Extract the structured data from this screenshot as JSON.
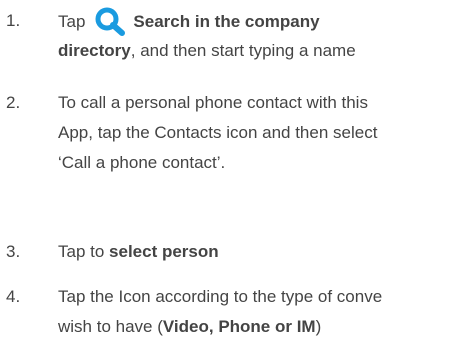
{
  "steps": [
    {
      "number": "1.",
      "prefix": "Tap",
      "icon": "search-icon",
      "icon_color": "#1a9be0",
      "bold_a": "Search in the company",
      "bold_b": "directory",
      "rest": ", and then start typing a name"
    },
    {
      "number": "2.",
      "line1": "To call a personal phone contact with this",
      "line2": "App, tap the Contacts icon and then select",
      "line3": "‘Call a phone contact’."
    },
    {
      "number": "3.",
      "prefix": "Tap to ",
      "bold": "select person"
    },
    {
      "number": "4.",
      "line1": "Tap the Icon according to the type of conve",
      "line2_prefix": "wish to have (",
      "line2_bold": "Video, Phone or IM",
      "line2_suffix": ")"
    }
  ]
}
